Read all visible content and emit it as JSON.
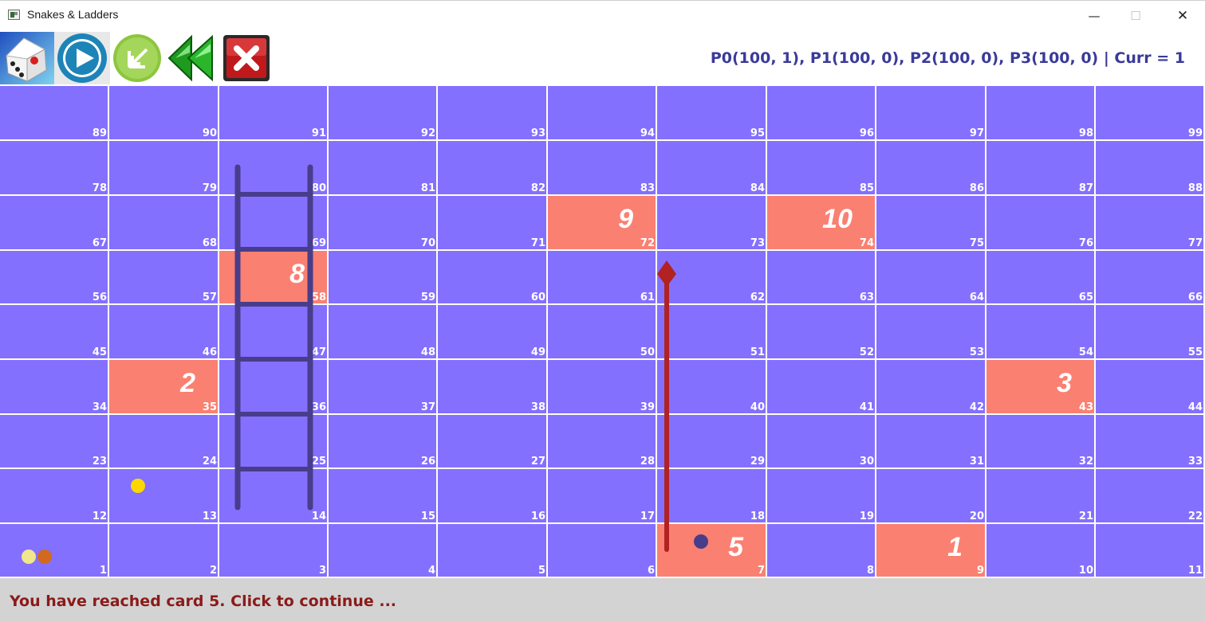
{
  "window": {
    "title": "Snakes & Ladders",
    "min_glyph": "—",
    "max_glyph": "☐",
    "close_glyph": "✕"
  },
  "toolbar": {
    "buttons": [
      {
        "name": "roll-dice-button",
        "icon": "dice-icon"
      },
      {
        "name": "play-button",
        "icon": "play-icon"
      },
      {
        "name": "import-button",
        "icon": "arrow-down-left-icon"
      },
      {
        "name": "rewind-button",
        "icon": "rewind-icon"
      },
      {
        "name": "exit-button",
        "icon": "close-x-icon"
      }
    ],
    "status": "P0(100, 1), P1(100, 0), P2(100, 0), P3(100, 0) | Curr = 1"
  },
  "board": {
    "columns": 11,
    "rows": 9,
    "numbers_bottom_to_top": [
      [
        1,
        2,
        3,
        4,
        5,
        6,
        7,
        8,
        9,
        10,
        11
      ],
      [
        12,
        13,
        14,
        15,
        16,
        17,
        18,
        19,
        20,
        21,
        22
      ],
      [
        23,
        24,
        25,
        26,
        27,
        28,
        29,
        30,
        31,
        32,
        33
      ],
      [
        34,
        35,
        36,
        37,
        38,
        39,
        40,
        41,
        42,
        43,
        44
      ],
      [
        45,
        46,
        47,
        48,
        49,
        50,
        51,
        52,
        53,
        54,
        55
      ],
      [
        56,
        57,
        58,
        59,
        60,
        61,
        62,
        63,
        64,
        65,
        66
      ],
      [
        67,
        68,
        69,
        70,
        71,
        72,
        73,
        74,
        75,
        76,
        77
      ],
      [
        78,
        79,
        80,
        81,
        82,
        83,
        84,
        85,
        86,
        87,
        88
      ],
      [
        89,
        90,
        91,
        92,
        93,
        94,
        95,
        96,
        97,
        98,
        99
      ]
    ],
    "cards": [
      {
        "cell": 9,
        "label": "1"
      },
      {
        "cell": 35,
        "label": "2"
      },
      {
        "cell": 43,
        "label": "3"
      },
      {
        "cell": 7,
        "label": "5"
      },
      {
        "cell": 58,
        "label": "8"
      },
      {
        "cell": 72,
        "label": "9"
      },
      {
        "cell": 74,
        "label": "10"
      }
    ],
    "ladders": [
      {
        "from": 15,
        "to": 81
      }
    ],
    "snakes": [
      {
        "head": 61,
        "tail": 7
      }
    ],
    "tokens": [
      {
        "cell": 1,
        "color": "#F0E68C"
      },
      {
        "cell": 1,
        "color": "#D2691E"
      },
      {
        "cell": 13,
        "color": "#FFD700"
      },
      {
        "cell": 7,
        "color": "#483D8B"
      }
    ],
    "colors": {
      "cell": "#8470FF",
      "card": "#FA8072",
      "grid": "#FFFFFF",
      "ladder": "#483D8B",
      "snake": "#B22222"
    }
  },
  "footer": {
    "message": "You have reached card 5. Click to continue ..."
  }
}
